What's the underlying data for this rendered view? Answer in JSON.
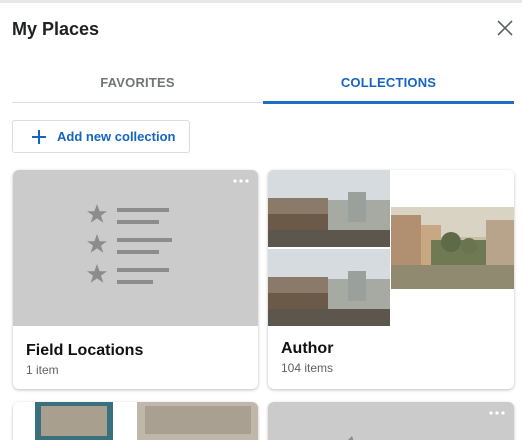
{
  "header": {
    "title": "My Places",
    "close_icon": "close-icon"
  },
  "tabs": [
    {
      "label": "FAVORITES",
      "active": false
    },
    {
      "label": "COLLECTIONS",
      "active": true
    }
  ],
  "accent_color": "#1a6fc2",
  "add_button": {
    "label": "Add new collection",
    "icon": "plus-icon"
  },
  "collections": [
    {
      "name": "Field Locations",
      "count": "1 item",
      "thumbnail": "starred-list-icon"
    },
    {
      "name": "Author",
      "count": "104 items",
      "thumbnail": "photo-collage"
    }
  ],
  "more_icon": "more-options-icon"
}
